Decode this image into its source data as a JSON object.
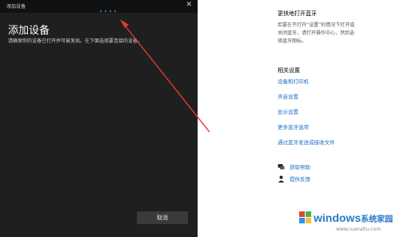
{
  "dialog": {
    "window_title": "添加设备",
    "heading": "添加设备",
    "description": "请确保你的设备已打开并可被发现。在下面选择要连接的设备。",
    "cancel_label": "取消",
    "close_icon": "close-icon",
    "progress_color": "#3b8fe0"
  },
  "settings": {
    "heading": "更快地打开蓝牙",
    "paragraph": "若要在不打开“设置”的情况下打开或关闭蓝牙，请打开操作中心，然后选择蓝牙图标。",
    "related_heading": "相关设置",
    "related_links": [
      "设备和打印机",
      "声音设置",
      "显示设置",
      "更多蓝牙选项",
      "通过蓝牙发送或接收文件"
    ],
    "help_label": "获取帮助",
    "feedback_label": "提供反馈",
    "link_color": "#1a6fc8"
  },
  "annotation": {
    "arrow_color": "#e53935"
  },
  "watermark": {
    "text": "windows",
    "suffix": "系统家园",
    "url": "www.ruanaitu.com"
  }
}
